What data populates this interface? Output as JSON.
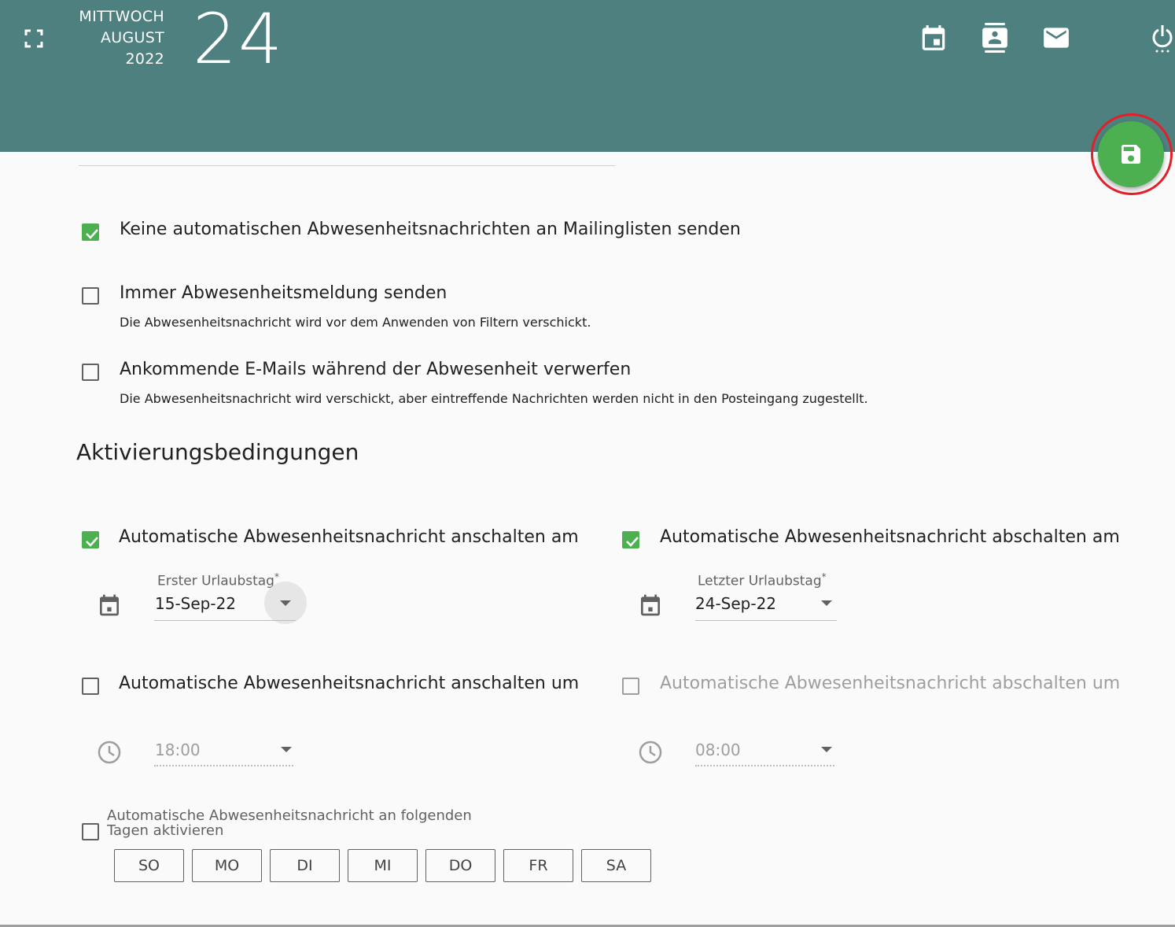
{
  "header": {
    "weekday": "MITTWOCH",
    "month": "AUGUST",
    "year": "2022",
    "day": "24",
    "background_color": "#4e8080",
    "icons": [
      "fullscreen-icon",
      "calendar-icon",
      "contacts-icon",
      "mail-icon",
      "power-icon"
    ]
  },
  "save_button": {
    "icon": "save-icon",
    "color": "#4caf50"
  },
  "options": {
    "no_mailinglists": {
      "label": "Keine automatischen Abwesenheitsnachrichten an Mailinglisten senden",
      "checked": true
    },
    "always_send": {
      "label": "Immer Abwesenheitsmeldung senden",
      "hint": "Die Abwesenheitsnachricht wird vor dem Anwenden von Filtern verschickt.",
      "checked": false
    },
    "discard_incoming": {
      "label": "Ankommende E-Mails während der Abwesenheit verwerfen",
      "hint": "Die Abwesenheitsnachricht wird verschickt, aber eintreffende Nachrichten werden nicht in den Posteingang zugestellt.",
      "checked": false
    }
  },
  "activation": {
    "title": "Aktivierungsbedingungen",
    "start_date": {
      "label": "Automatische Abwesenheitsnachricht anschalten am",
      "checked": true,
      "field_label": "Erster Urlaubstag",
      "required_mark": "*",
      "value": "15-Sep-22"
    },
    "end_date": {
      "label": "Automatische Abwesenheitsnachricht abschalten am",
      "checked": true,
      "field_label": "Letzter Urlaubstag",
      "required_mark": "*",
      "value": "24-Sep-22"
    },
    "start_time": {
      "label": "Automatische Abwesenheitsnachricht anschalten um",
      "checked": false,
      "value": "18:00"
    },
    "end_time": {
      "label": "Automatische Abwesenheitsnachricht abschalten um",
      "checked": false,
      "disabled": true,
      "value": "08:00"
    },
    "weekdays": {
      "label": "Automatische Abwesenheitsnachricht an folgenden Tagen aktivieren",
      "checked": false,
      "days": [
        "SO",
        "MO",
        "DI",
        "MI",
        "DO",
        "FR",
        "SA"
      ]
    }
  },
  "accent_color": "#4caf50"
}
